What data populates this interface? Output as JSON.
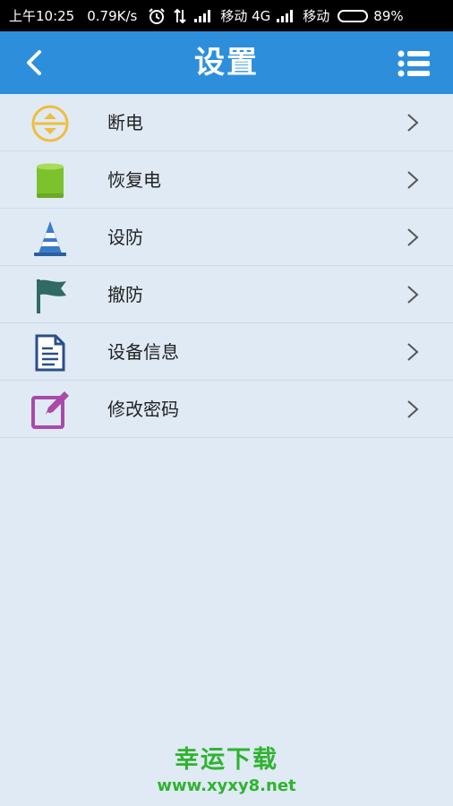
{
  "status_bar": {
    "time": "上午10:25",
    "speed": "0.79K/s",
    "carrier1": "移动 4G",
    "carrier2": "移动",
    "battery": "89%",
    "battery_level": 0.89
  },
  "header": {
    "title": "设置",
    "back_icon": "chevron-left-icon",
    "menu_icon": "list-icon"
  },
  "items": [
    {
      "label": "断电",
      "icon": "power-off-icon",
      "color": "#f0bd3c"
    },
    {
      "label": "恢复电",
      "icon": "battery-icon",
      "color": "#7cc22d"
    },
    {
      "label": "设防",
      "icon": "cone-icon",
      "color": "#3a7cc9"
    },
    {
      "label": "撤防",
      "icon": "flag-icon",
      "color": "#2f6a64"
    },
    {
      "label": "设备信息",
      "icon": "document-icon",
      "color": "#2a4e88"
    },
    {
      "label": "修改密码",
      "icon": "edit-icon",
      "color": "#a94aa8"
    }
  ],
  "watermark": {
    "name": "幸运下载",
    "url": "www.xyxy8.net"
  },
  "colors": {
    "header_bg": "#2d8fdc",
    "page_bg": "#dfeaf5",
    "watermark": "#2fb32f"
  }
}
